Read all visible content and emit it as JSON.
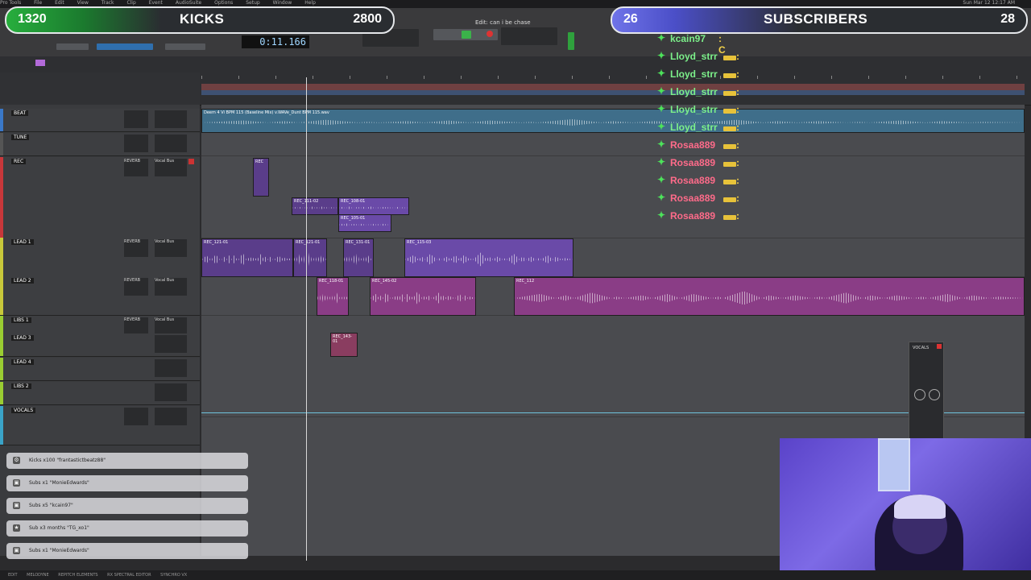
{
  "menubar": {
    "items": [
      "Pro Tools",
      "File",
      "Edit",
      "View",
      "Track",
      "Clip",
      "Event",
      "AudioSuite",
      "Options",
      "Setup",
      "Window",
      "Help"
    ],
    "clock": "Sun Mar 12  12:17 AM"
  },
  "toolbar": {
    "counter": "0:11.166",
    "project_title": "Edit: can i be chase"
  },
  "banner_kicks": {
    "left_num": "1320",
    "label": "KICKS",
    "right_num": "2800"
  },
  "banner_subs": {
    "left_num": "26",
    "label": "SUBSCRIBERS",
    "right_num": "28"
  },
  "chat": [
    {
      "user": "kcain97",
      "msg": ": C",
      "color": "#7cf08a"
    },
    {
      "user": "Lloyd_strr",
      "msg": ":",
      "color": "#7cf08a"
    },
    {
      "user": "Lloyd_strr",
      "msg": ":",
      "color": "#7cf08a"
    },
    {
      "user": "Lloyd_strr",
      "msg": ":",
      "color": "#7cf08a"
    },
    {
      "user": "Lloyd_strr",
      "msg": ":",
      "color": "#7cf08a"
    },
    {
      "user": "Lloyd_strr",
      "msg": ":",
      "color": "#7cf08a"
    },
    {
      "user": "Rosaa889",
      "msg": ":",
      "color": "#ff6b8a"
    },
    {
      "user": "Rosaa889",
      "msg": ":",
      "color": "#ff6b8a"
    },
    {
      "user": "Rosaa889",
      "msg": ":",
      "color": "#ff6b8a"
    },
    {
      "user": "Rosaa889",
      "msg": ":",
      "color": "#ff6b8a"
    },
    {
      "user": "Rosaa889",
      "msg": ":",
      "color": "#ff6b8a"
    }
  ],
  "tracks": [
    {
      "name": "BEAT",
      "color": "#3a78c8",
      "insert": "",
      "io": ""
    },
    {
      "name": "TUNE",
      "color": "#555",
      "insert": "",
      "io": ""
    },
    {
      "name": "REC",
      "color": "#c8373a",
      "insert": "REVERB",
      "io": "Vocal Bus"
    },
    {
      "name": "LEAD 1",
      "color": "#c8c83a",
      "insert": "REVERB",
      "io": "Vocal Bus"
    },
    {
      "name": "LEAD 2",
      "color": "#c8c83a",
      "insert": "REVERB",
      "io": "Vocal Bus"
    },
    {
      "name": "LIBS 1",
      "color": "#9acd32",
      "insert": "REVERB",
      "io": "Vocal Bus"
    },
    {
      "name": "LEAD 3",
      "color": "#9acd32",
      "insert": "",
      "io": ""
    },
    {
      "name": "LEAD 4",
      "color": "#9acd32",
      "insert": "",
      "io": ""
    },
    {
      "name": "LIBS 2",
      "color": "#9acd32",
      "insert": "",
      "io": ""
    },
    {
      "name": "VOCALS",
      "color": "#3aa3c8",
      "insert": "",
      "io": ""
    }
  ],
  "clips": {
    "beat": "Deem 4 Vi BPM 115 (Baseline Mix) v.WAVe_Dunt BPM 115.wav",
    "rec_a": "REC",
    "rec_b": "REC_111-02",
    "rec_c": "REC_108-01",
    "rec_d": "REC_105-01",
    "lead1_a": "REC_121-01",
    "lead1_b": "REC_121-01",
    "lead1_c": "REC_131-01",
    "lead1_d": "REC_115-03",
    "lead2_a": "REC_118-01",
    "lead2_b": "REC_145-02",
    "lead2_c": "REC_112",
    "libs_a": "REC_143-01"
  },
  "alerts": [
    {
      "icon": "⚙",
      "text": "Kicks x100 \"frantastictbeatz88\""
    },
    {
      "icon": "▣",
      "text": "Subs x1 \"MonieEdwards\""
    },
    {
      "icon": "▣",
      "text": "Subs x5 \"kcain97\""
    },
    {
      "icon": "★",
      "text": "Sub x3 months \"TG_xo1\""
    },
    {
      "icon": "▣",
      "text": "Subs x1 \"MonieEdwards\""
    }
  ],
  "bottombar": {
    "items": [
      "EDIT",
      "MELODYNE",
      "REPITCH ELEMENTS",
      "RX SPECTRAL EDITOR",
      "SYNCHRO VX"
    ]
  },
  "plugin": {
    "title": "VOCALS"
  }
}
